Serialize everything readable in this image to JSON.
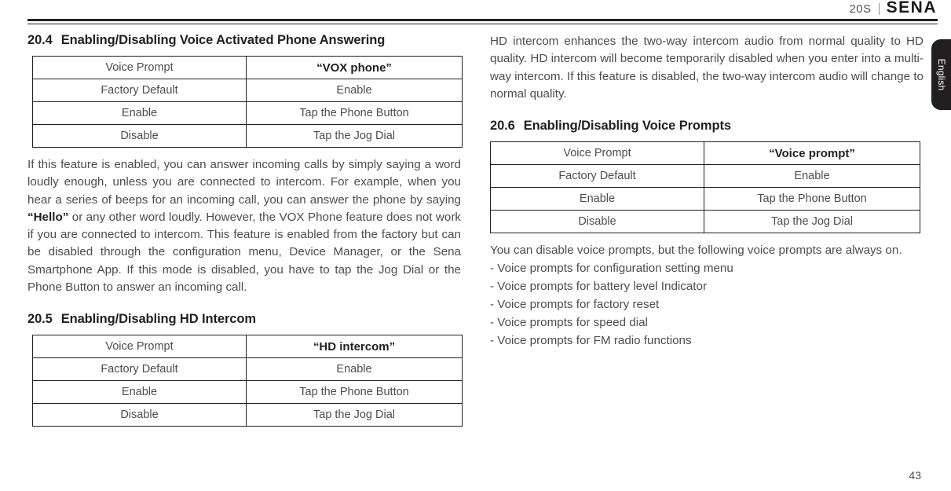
{
  "header": {
    "model": "20S",
    "brand": "SENA",
    "separator": "|"
  },
  "language_tab": {
    "label": "English"
  },
  "footer": {
    "page_number": "43"
  },
  "table_columns": {
    "row_label_header": "Voice Prompt",
    "rows_labels": [
      "Factory Default",
      "Enable",
      "Disable"
    ]
  },
  "left_column": {
    "section_20_4": {
      "number": "20.4",
      "title": "Enabling/Disabling Voice Activated Phone Answering",
      "table": {
        "head": {
          "label": "Voice Prompt",
          "value": "“VOX phone”"
        },
        "rows": [
          {
            "label": "Factory Default",
            "value": "Enable"
          },
          {
            "label": "Enable",
            "value": "Tap the Phone Button"
          },
          {
            "label": "Disable",
            "value": "Tap the Jog Dial"
          }
        ]
      },
      "paragraph_part1": "If this feature is enabled, you can answer incoming calls by simply saying a word loudly enough, unless you are connected to intercom. For example, when you hear a series of beeps for an incoming call, you can answer the phone by saying ",
      "paragraph_bold": "“Hello”",
      "paragraph_part2": " or any other word loudly. However, the VOX Phone feature does not work if you are connected to intercom. This feature is enabled from the factory but can be disabled through the configuration menu, Device Manager, or the Sena Smartphone App. If this mode is disabled, you have to tap the Jog Dial or the Phone Button to answer an incoming call."
    },
    "section_20_5": {
      "number": "20.5",
      "title": "Enabling/Disabling HD Intercom",
      "table": {
        "head": {
          "label": "Voice Prompt",
          "value": "“HD intercom”"
        },
        "rows": [
          {
            "label": "Factory Default",
            "value": "Enable"
          },
          {
            "label": "Enable",
            "value": "Tap the Phone Button"
          },
          {
            "label": "Disable",
            "value": "Tap the Jog Dial"
          }
        ]
      }
    }
  },
  "right_column": {
    "hd_intercom_paragraph": "HD intercom enhances the two-way intercom audio from normal quality to HD quality. HD intercom will become temporarily disabled when you enter into a multi-way intercom. If this feature is disabled, the two-way intercom audio will change to normal quality.",
    "section_20_6": {
      "number": "20.6",
      "title": "Enabling/Disabling Voice Prompts",
      "table": {
        "head": {
          "label": "Voice Prompt",
          "value": "“Voice prompt”"
        },
        "rows": [
          {
            "label": "Factory Default",
            "value": "Enable"
          },
          {
            "label": "Enable",
            "value": "Tap the Phone Button"
          },
          {
            "label": "Disable",
            "value": "Tap the Jog Dial"
          }
        ]
      },
      "intro": "You can disable voice prompts, but the following voice prompts are always on.",
      "always_on_items": [
        "- Voice prompts for configuration setting menu",
        "- Voice prompts for battery level Indicator",
        "- Voice prompts for factory reset",
        "- Voice prompts for speed dial",
        "- Voice prompts for FM radio functions"
      ]
    }
  }
}
